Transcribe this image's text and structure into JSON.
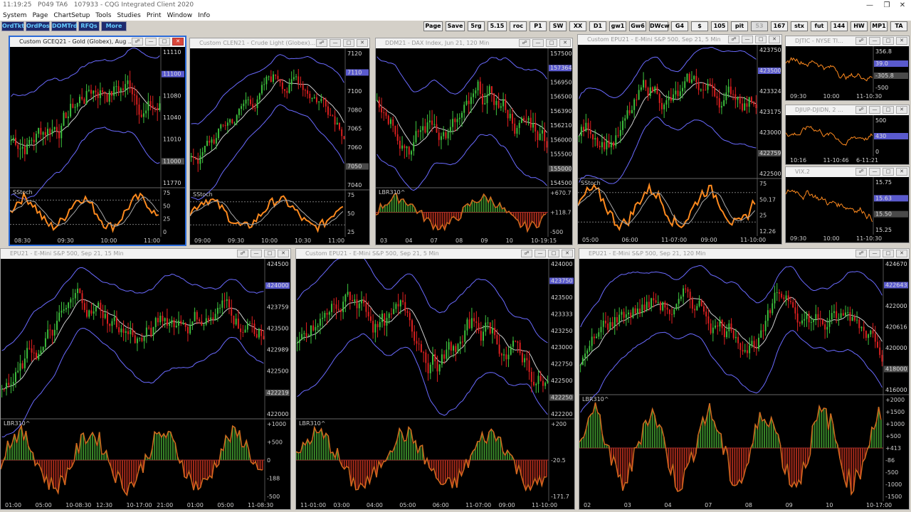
{
  "titlebar": {
    "time": "11:19:25",
    "account": "P049 TA6",
    "session": "107933",
    "app": "CQG Integrated Client 2020"
  },
  "menu": [
    "System",
    "Page",
    "ChartSetup",
    "Tools",
    "Studies",
    "Print",
    "Window",
    "Info"
  ],
  "left_buttons": [
    "OrdTkt",
    "OrdPos",
    "DOMTrd",
    "RFQs",
    "More"
  ],
  "right_buttons": [
    "Page",
    "Save",
    "5rg",
    "5.15",
    "roc",
    "P1",
    "SW",
    "XX",
    "D1",
    "gw1",
    "Gw6",
    "DWcw",
    "G4",
    "$",
    "105",
    "pit",
    "53",
    "167",
    "stx",
    "fut",
    "144",
    "HW",
    "MP1",
    "TA"
  ],
  "windows": {
    "gold": {
      "title": "Custom GCEQ21 - Gold (Globex), Aug ...",
      "prices": [
        "11110",
        "11100",
        "11080",
        "11040",
        "11010",
        "11000",
        "11770"
      ],
      "ind": "SStoch",
      "ind_vals": [
        "75",
        "50",
        "25",
        "0"
      ],
      "times": [
        "08:30",
        "09:30",
        "10:00",
        "11:00"
      ]
    },
    "crude": {
      "title": "Custom CLEN21 - Crude Light (Globex)...",
      "prices": [
        "7120",
        "7110",
        "7100",
        "7080",
        "7065",
        "7060",
        "7050",
        "7040"
      ],
      "ind": "SStoch",
      "ind_vals": [
        "75",
        "50",
        "25"
      ],
      "times": [
        "09:00",
        "09:30",
        "10:00",
        "10:30",
        "11:00"
      ]
    },
    "dax": {
      "title": "DDM21 - DAX Index, Jun 21, 120 Min",
      "prices": [
        "157500",
        "157364",
        "156950",
        "156500",
        "156390",
        "156210",
        "156000",
        "155500",
        "155000",
        "154500"
      ],
      "ind": "LBR310^",
      "ind_vals": [
        "+670.7",
        "+118.7",
        "-500"
      ],
      "times": [
        "03",
        "04",
        "07",
        "08",
        "09",
        "10",
        "10-19:15"
      ]
    },
    "es5a": {
      "title": "Custom EPU21 - E-Mini S&P 500, Sep 21, 5 Min",
      "prices": [
        "423750",
        "423500",
        "423324",
        "423175",
        "423000",
        "422759",
        "422500"
      ],
      "ind": "SStoch",
      "ind_vals": [
        "75",
        "50.17",
        "25",
        "12.26"
      ],
      "times": [
        "05:00",
        "06:00",
        "11-07:00",
        "09:00",
        "11-10:00"
      ]
    },
    "nyse": {
      "title": "DJTIC - NYSE TI...",
      "prices": [
        "356.8",
        "39.0",
        "-305.8",
        "-500"
      ],
      "times": [
        "09:30",
        "10:00",
        "11-10:30"
      ]
    },
    "diup": {
      "title": "DJIUP-DJIDN, 2 ...",
      "prices": [
        "500",
        "430",
        "0"
      ],
      "times": [
        "10:16",
        "11-10:46",
        "6-11:21"
      ]
    },
    "vix": {
      "title": "VIX.2",
      "prices": [
        "15.75",
        "15.63",
        "15.50",
        "15.25"
      ],
      "times": [
        "09:30",
        "10:00",
        "11-10:30"
      ]
    },
    "es15": {
      "title": "EPU21 - E-Mini S&P 500, Sep 21, 15 Min",
      "prices": [
        "424500",
        "424000",
        "423759",
        "423500",
        "422989",
        "422500",
        "422219",
        "422000"
      ],
      "ind": "LBR310^",
      "ind_vals": [
        "+1000",
        "+500",
        "0",
        "-188",
        "-500"
      ],
      "times": [
        "01:00",
        "05:00",
        "10-08:30",
        "12:30",
        "10-17:00",
        "21:00",
        "01:00",
        "05:00",
        "11-08:30"
      ]
    },
    "es5b": {
      "title": "Custom EPU21 - E-Mini S&P 500, Sep 21, 5 Min",
      "prices": [
        "424000",
        "423750",
        "423500",
        "423333",
        "423250",
        "423000",
        "422750",
        "422500",
        "422250",
        "422200"
      ],
      "ind": "LBR310^",
      "ind_vals": [
        "+200",
        "-20.5",
        "-171.7"
      ],
      "times": [
        "11-01:00",
        "03:00",
        "04:00",
        "05:00",
        "06:00",
        "11-07:00",
        "09:00",
        "11-10:00"
      ]
    },
    "es120": {
      "title": "EPU21 - E-Mini S&P 500, Sep 21, 120 Min",
      "prices": [
        "424670",
        "422643",
        "422000",
        "420616",
        "420000",
        "418000",
        "416000"
      ],
      "ind": "LBR310^",
      "ind_vals": [
        "+2000",
        "+1500",
        "+1000",
        "+500",
        "+413",
        "-86",
        "-500",
        "-1000",
        "-1500"
      ],
      "times": [
        "02",
        "03",
        "04",
        "07",
        "08",
        "09",
        "10",
        "10-17:00"
      ]
    }
  },
  "colors": {
    "up": "#3ec23e",
    "down": "#e02020",
    "band": "#6a6aff",
    "ma": "#cfcfcf",
    "stoch": "#ff8a1e"
  }
}
